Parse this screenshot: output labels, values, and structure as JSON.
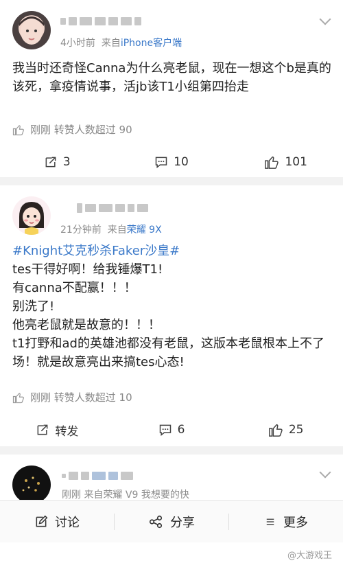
{
  "posts": [
    {
      "meta": {
        "time": "4小时前",
        "via": "来自",
        "source": "iPhone客户端"
      },
      "content": [
        "我当时还奇怪Canna为什么亮老鼠，现在一想这个b是真的该死，拿疫情说事，活jb该T1小组第四抬走"
      ],
      "like_line": "刚刚 转赞人数超过 90",
      "actions": {
        "repost": "3",
        "comment": "10",
        "like": "101"
      }
    },
    {
      "meta": {
        "time": "21分钟前",
        "via": "来自",
        "source": "荣耀 9X"
      },
      "topic": "#Knight艾克秒杀Faker沙皇#",
      "content": [
        "tes干得好啊！给我锤爆T1!",
        "有canna不配赢！！！",
        "别洗了!",
        "他亮老鼠就是故意的！！！",
        "t1打野和ad的英雄池都没有老鼠，这版本老鼠根本上不了场！就是故意亮出来搞tes心态!"
      ],
      "like_line": "刚刚 转赞人数超过 10",
      "actions": {
        "repost": "转发",
        "comment": "6",
        "like": "25"
      }
    },
    {
      "meta": {
        "line": "刚刚 来自荣耀 V9 我想要的快"
      }
    }
  ],
  "tabbar": {
    "comment": "讨论",
    "share": "分享",
    "more": "更多"
  },
  "watermark": "@大游戏王",
  "colors": {
    "link": "#3b79c9",
    "meta": "#8b8b8b",
    "separator": "#f2f2f2"
  }
}
